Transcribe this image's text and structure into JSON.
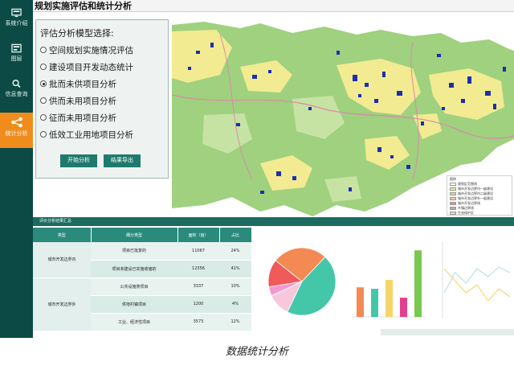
{
  "app": {
    "title": "规划实施评估和统计分析"
  },
  "sidebar": {
    "items": [
      {
        "label": "系统介绍",
        "icon": "monitor-icon"
      },
      {
        "label": "图层",
        "icon": "layers-icon"
      },
      {
        "label": "信息查询",
        "icon": "search-icon"
      },
      {
        "label": "统计分析",
        "icon": "share-icon",
        "active": true
      }
    ]
  },
  "panel": {
    "heading": "评估分析模型选择:",
    "options": [
      {
        "label": "空间规划实施情况评估",
        "checked": false
      },
      {
        "label": "建设项目开发动态统计",
        "checked": false
      },
      {
        "label": "批而未供项目分析",
        "checked": true
      },
      {
        "label": "供而未用项目分析",
        "checked": false
      },
      {
        "label": "征而未用项目分析",
        "checked": false
      },
      {
        "label": "低效工业用地项目分析",
        "checked": false
      }
    ],
    "start_button": "开始分析",
    "export_button": "结果导出"
  },
  "map": {
    "legend_title": "图例",
    "legend_items": [
      {
        "label": "规划区范围线",
        "color": "#ffffff"
      },
      {
        "label": "城市开发边界内一级建设",
        "color": "#f3ec8f"
      },
      {
        "label": "城市开发边界内二级建设",
        "color": "#c9e19b"
      },
      {
        "label": "城市开发边界外一般建设",
        "color": "#f6c7a0"
      },
      {
        "label": "城市开发边界线",
        "color": "#e28aa7"
      },
      {
        "label": "乡镇边界线",
        "color": "#b0b0b0"
      },
      {
        "label": "生态保护区",
        "color": "#cfe8b8"
      }
    ]
  },
  "stats": {
    "title": "评价分析结果汇总",
    "columns": [
      "类型",
      "细分类型",
      "面积（亩）",
      "占比"
    ],
    "groups": [
      {
        "name": "城市开发边界内",
        "rows": [
          {
            "sub": "项目已批复的",
            "area": "11067",
            "ratio": "24%"
          },
          {
            "sub": "项目未建设已实施收储的",
            "area": "12356",
            "ratio": "41%"
          }
        ]
      },
      {
        "name": "城市开发边界外",
        "rows": [
          {
            "sub": "公共设施类项目",
            "area": "3337",
            "ratio": "10%"
          },
          {
            "sub": "供地村镇项目",
            "area": "1200",
            "ratio": "4%"
          },
          {
            "sub": "工业、经济性项目",
            "area": "3573",
            "ratio": "12%"
          }
        ]
      }
    ]
  },
  "chart_data": [
    {
      "type": "pie",
      "values": [
        24,
        41,
        10,
        4,
        12
      ],
      "colors": [
        "#f38a54",
        "#43c7a8",
        "#f7c8dc",
        "#f29ad0",
        "#f05a5a"
      ]
    },
    {
      "type": "bar",
      "values": [
        40,
        38,
        50,
        26,
        90
      ],
      "colors": [
        "#f38a54",
        "#43c7a8",
        "#f5d56a",
        "#e2408c",
        "#79c84f"
      ]
    },
    {
      "type": "line",
      "series": [
        {
          "values": [
            60,
            45,
            30,
            40,
            20,
            35,
            25
          ],
          "color": "#f5d56a"
        },
        {
          "values": [
            30,
            55,
            42,
            60,
            50,
            62,
            55
          ],
          "color": "#b6dfe6"
        }
      ]
    }
  ],
  "caption": "数据统计分析"
}
